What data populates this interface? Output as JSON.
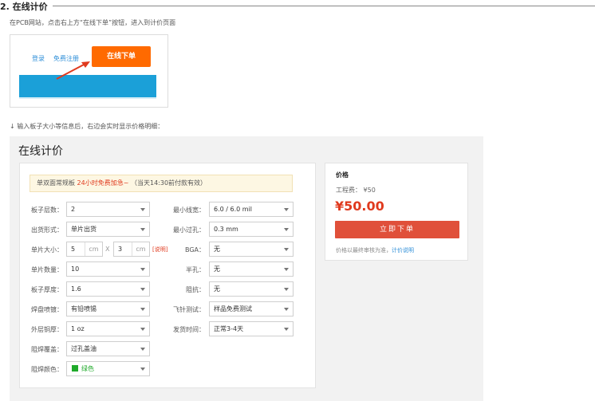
{
  "section": {
    "title": "2. 在线计价",
    "step1": "在PCB网站，点击右上方“在线下单”按钮，进入到计价页面",
    "step2": "↓ 输入板子大小等信息后，右边会实时显示价格明细："
  },
  "screenshot": {
    "login": "登录",
    "register": "免费注册",
    "order_online": "在线下单"
  },
  "panel": {
    "title": "在线计价",
    "notice_prefix": "单双面常规板",
    "notice_highlight": "24小时免费加急~",
    "notice_suffix": "（当天14:30前付款有效）",
    "left_fields": [
      {
        "label": "板子层数：",
        "value": "2"
      },
      {
        "label": "出货形式：",
        "value": "单片出货"
      },
      {
        "label": "单片大小：",
        "w": "5",
        "h": "3",
        "unit": "cm",
        "sep": "X",
        "explain": "[说明]"
      },
      {
        "label": "单片数量：",
        "value": "10"
      },
      {
        "label": "板子厚度：",
        "value": "1.6"
      },
      {
        "label": "焊盘喷镀：",
        "value": "有铅喷锡"
      },
      {
        "label": "外层铜厚：",
        "value": "1 oz"
      },
      {
        "label": "阻焊覆盖：",
        "value": "过孔盖油"
      },
      {
        "label": "阻焊颜色：",
        "value": "绿色",
        "color": "#1faa2a"
      }
    ],
    "right_fields": [
      {
        "label": "最小线宽：",
        "value": "6.0 / 6.0 mil"
      },
      {
        "label": "最小过孔：",
        "value": "0.3 mm"
      },
      {
        "label": "BGA：",
        "value": "无"
      },
      {
        "label": "半孔：",
        "value": "无"
      },
      {
        "label": "阻抗：",
        "value": "无"
      },
      {
        "label": "飞针测试：",
        "value": "样品免费测试"
      },
      {
        "label": "发货时间：",
        "value": "正常3-4天"
      }
    ]
  },
  "price": {
    "title": "价格",
    "engineering_fee": "工程费： ¥50",
    "total": "¥50.00",
    "order_button": "立即下单",
    "note_prefix": "价格以最终审核为准，",
    "note_link": "计价说明"
  },
  "colors": {
    "accent_orange": "#ff6a00",
    "price_red": "#e03a1e",
    "order_button": "#e0503a",
    "link_blue": "#2f8fd8",
    "banner_blue": "#1ba0d8"
  }
}
